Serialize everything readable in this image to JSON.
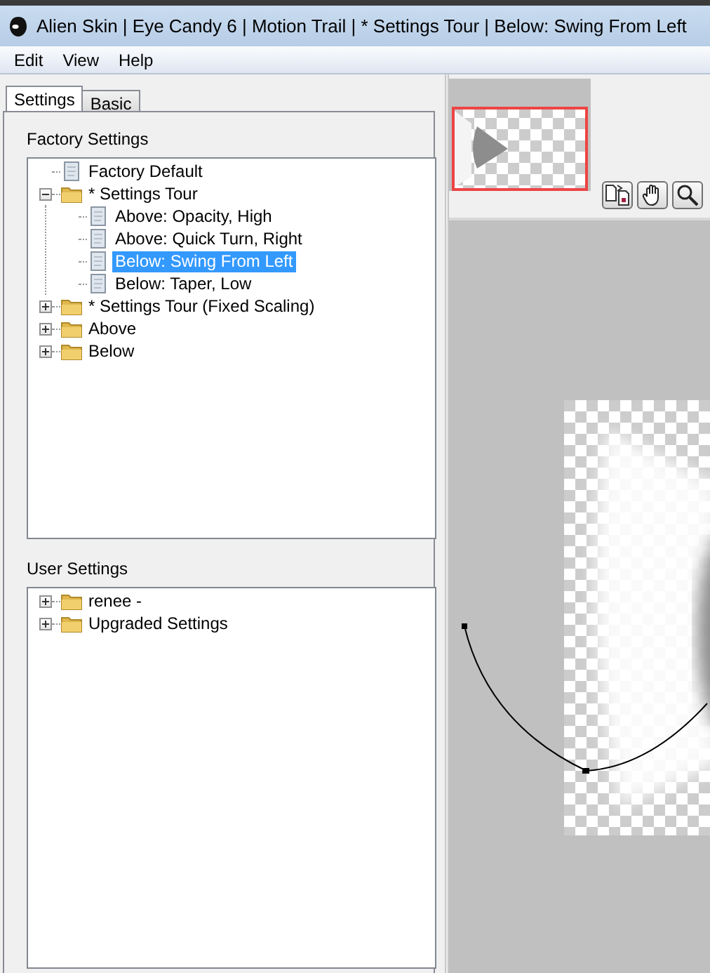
{
  "window": {
    "title": "Alien Skin | Eye Candy 6 | Motion Trail | * Settings Tour | Below: Swing From Left"
  },
  "menu": [
    {
      "label": "Edit"
    },
    {
      "label": "View"
    },
    {
      "label": "Help"
    }
  ],
  "tabs": [
    {
      "label": "Settings",
      "selected": true
    },
    {
      "label": "Basic",
      "selected": false
    }
  ],
  "factory_settings": {
    "label": "Factory Settings",
    "items": [
      {
        "kind": "preset",
        "label": "Factory Default",
        "selected": false
      },
      {
        "kind": "folder",
        "label": "* Settings Tour",
        "expanded": true,
        "selected": false,
        "children": [
          {
            "kind": "preset",
            "label": "Above: Opacity, High",
            "selected": false
          },
          {
            "kind": "preset",
            "label": "Above: Quick Turn, Right",
            "selected": false
          },
          {
            "kind": "preset",
            "label": "Below: Swing From Left",
            "selected": true
          },
          {
            "kind": "preset",
            "label": "Below: Taper, Low",
            "selected": false
          }
        ]
      },
      {
        "kind": "folder",
        "label": "* Settings Tour (Fixed Scaling)",
        "expanded": false,
        "selected": false
      },
      {
        "kind": "folder",
        "label": "Above",
        "expanded": false,
        "selected": false
      },
      {
        "kind": "folder",
        "label": "Below",
        "expanded": false,
        "selected": false
      }
    ]
  },
  "user_settings": {
    "label": "User Settings",
    "items": [
      {
        "kind": "folder",
        "label": "renee -",
        "expanded": false,
        "selected": false
      },
      {
        "kind": "folder",
        "label": "Upgraded Settings",
        "expanded": false,
        "selected": false
      }
    ]
  }
}
